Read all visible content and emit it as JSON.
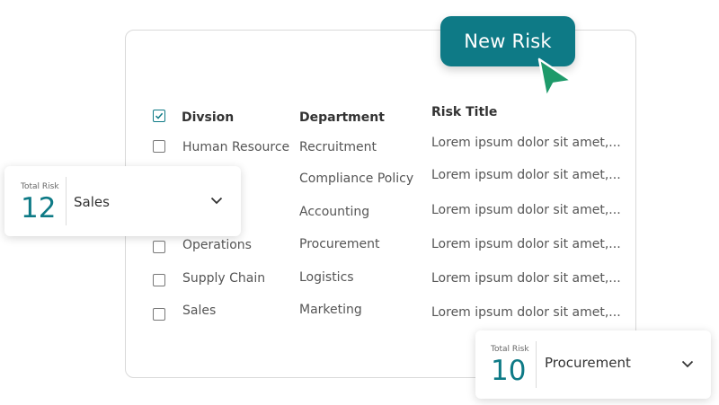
{
  "new_risk_button": {
    "label": "New Risk"
  },
  "table": {
    "headers": {
      "division": "Divsion",
      "department": "Department",
      "risk_title": "Risk Title"
    },
    "rows": [
      {
        "division": "Human Resource",
        "department": "Recruitment",
        "risk_title": "Lorem ipsum dolor sit amet,..."
      },
      {
        "division": "",
        "department": "Compliance Policy",
        "risk_title": "Lorem ipsum dolor sit amet,..."
      },
      {
        "division": "",
        "department": "Accounting",
        "risk_title": "Lorem ipsum dolor sit amet,..."
      },
      {
        "division": "Operations",
        "department": "Procurement",
        "risk_title": "Lorem ipsum dolor sit amet,..."
      },
      {
        "division": "Supply Chain",
        "department": "Logistics",
        "risk_title": "Lorem ipsum dolor sit amet,..."
      },
      {
        "division": "Sales",
        "department": "Marketing",
        "risk_title": "Lorem ipsum dolor sit amet,..."
      }
    ]
  },
  "card_sales": {
    "caption": "Total Risk",
    "count": "12",
    "selected": "Sales"
  },
  "card_procurement": {
    "caption": "Total Risk",
    "count": "10",
    "selected": "Procurement"
  },
  "colors": {
    "accent": "#0e7a86",
    "cursor": "#1e9a6a"
  }
}
